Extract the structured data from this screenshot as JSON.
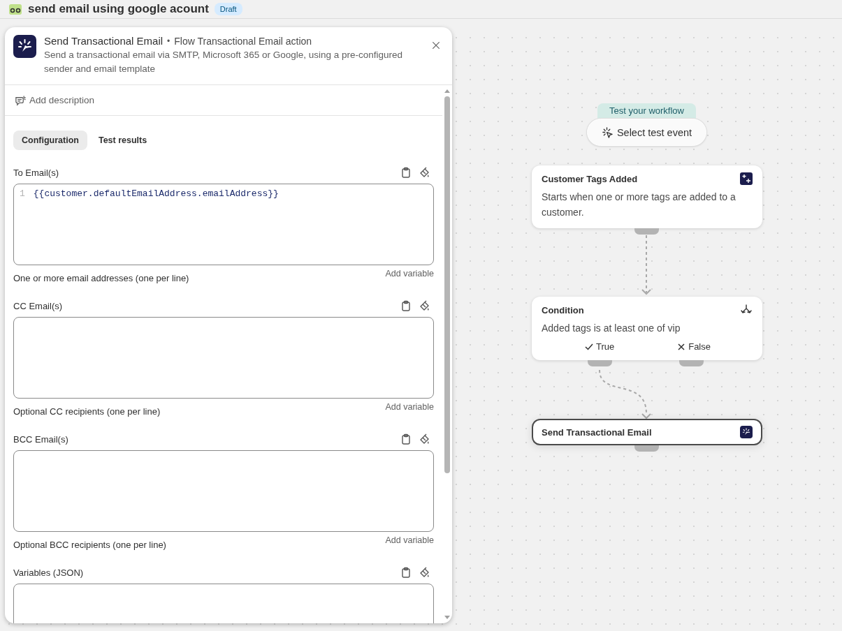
{
  "header": {
    "title": "send email using google acount",
    "badge": "Draft"
  },
  "panel": {
    "title": "Send Transactional Email",
    "separator": "•",
    "subtitle": "Flow Transactional Email action",
    "description": "Send a transactional email via SMTP, Microsoft 365 or Google, using a pre-configured sender and email template",
    "add_description": "Add description",
    "tabs": [
      {
        "label": "Configuration",
        "selected": true
      },
      {
        "label": "Test results",
        "selected": false
      }
    ],
    "fields": [
      {
        "label": "To Email(s)",
        "line_number": "1",
        "value": "{{customer.defaultEmailAddress.emailAddress}}",
        "help": "One or more email addresses (one per line)",
        "add_variable": "Add variable"
      },
      {
        "label": "CC Email(s)",
        "help": "Optional CC recipients (one per line)",
        "add_variable": "Add variable"
      },
      {
        "label": "BCC Email(s)",
        "help": "Optional BCC recipients (one per line)",
        "add_variable": "Add variable"
      },
      {
        "label": "Variables (JSON)"
      }
    ]
  },
  "canvas": {
    "test_label": "Test your workflow",
    "test_button": "Select test event",
    "nodes": [
      {
        "kind": "trigger",
        "title": "Customer Tags Added",
        "description": "Starts when one or more tags are added to a customer.",
        "selected": false
      },
      {
        "kind": "condition",
        "title": "Condition",
        "description": "Added tags is at least one of vip",
        "selected": false,
        "branches": [
          {
            "kind": "true",
            "label": "True"
          },
          {
            "kind": "false",
            "label": "False"
          }
        ]
      },
      {
        "kind": "action",
        "title": "Send Transactional Email",
        "selected": true
      }
    ]
  }
}
